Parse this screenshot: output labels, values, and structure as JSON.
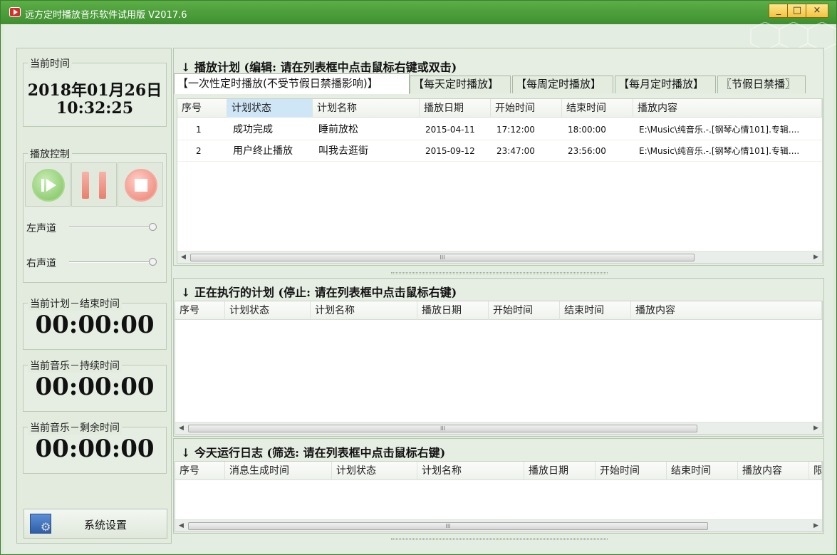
{
  "window": {
    "title": "远方定时播放音乐软件试用版 V2017.6",
    "minimize": "_",
    "maximize": "□",
    "close": "×"
  },
  "left": {
    "current_time": {
      "label": "当前时间",
      "date": "2018年01月26日",
      "time": "10:32:25"
    },
    "playback": {
      "label": "播放控制",
      "left_channel": "左声道",
      "right_channel": "右声道",
      "left_channel_level": 1.0,
      "right_channel_level": 1.0
    },
    "plan_end": {
      "label": "当前计划－结束时间",
      "value": "00:00:00"
    },
    "music_duration": {
      "label": "当前音乐－持续时间",
      "value": "00:00:00"
    },
    "music_remaining": {
      "label": "当前音乐－剩余时间",
      "value": "00:00:00"
    },
    "settings_label": "系统设置"
  },
  "schedule": {
    "title": "↓ 播放计划 (编辑: 请在列表框中点击鼠标右键或双击)",
    "tabs": [
      "【一次性定时播放(不受节假日禁播影响)】",
      "【每天定时播放】",
      "【每周定时播放】",
      "【每月定时播放】",
      "〖节假日禁播〗"
    ],
    "columns": [
      "序号",
      "计划状态",
      "计划名称",
      "播放日期",
      "开始时间",
      "结束时间",
      "播放内容"
    ],
    "rows": [
      [
        "1",
        "成功完成",
        "睡前放松",
        "2015-04-11",
        "17:12:00",
        "18:00:00",
        "E:\\Music\\纯音乐.-.[钢琴心情101].专辑...."
      ],
      [
        "2",
        "用户终止播放",
        "叫我去逛街",
        "2015-09-12",
        "23:47:00",
        "23:56:00",
        "E:\\Music\\纯音乐.-.[钢琴心情101].专辑...."
      ]
    ]
  },
  "running": {
    "title": "↓ 正在执行的计划 (停止: 请在列表框中点击鼠标右键)",
    "columns": [
      "序号",
      "计划状态",
      "计划名称",
      "播放日期",
      "开始时间",
      "结束时间",
      "播放内容"
    ]
  },
  "log": {
    "title": "↓ 今天运行日志 (筛选: 请在列表框中点击鼠标右键)",
    "columns": [
      "序号",
      "消息生成时间",
      "计划状态",
      "计划名称",
      "播放日期",
      "开始时间",
      "结束时间",
      "播放内容",
      "限"
    ]
  },
  "scroll_thumb_label": "III"
}
